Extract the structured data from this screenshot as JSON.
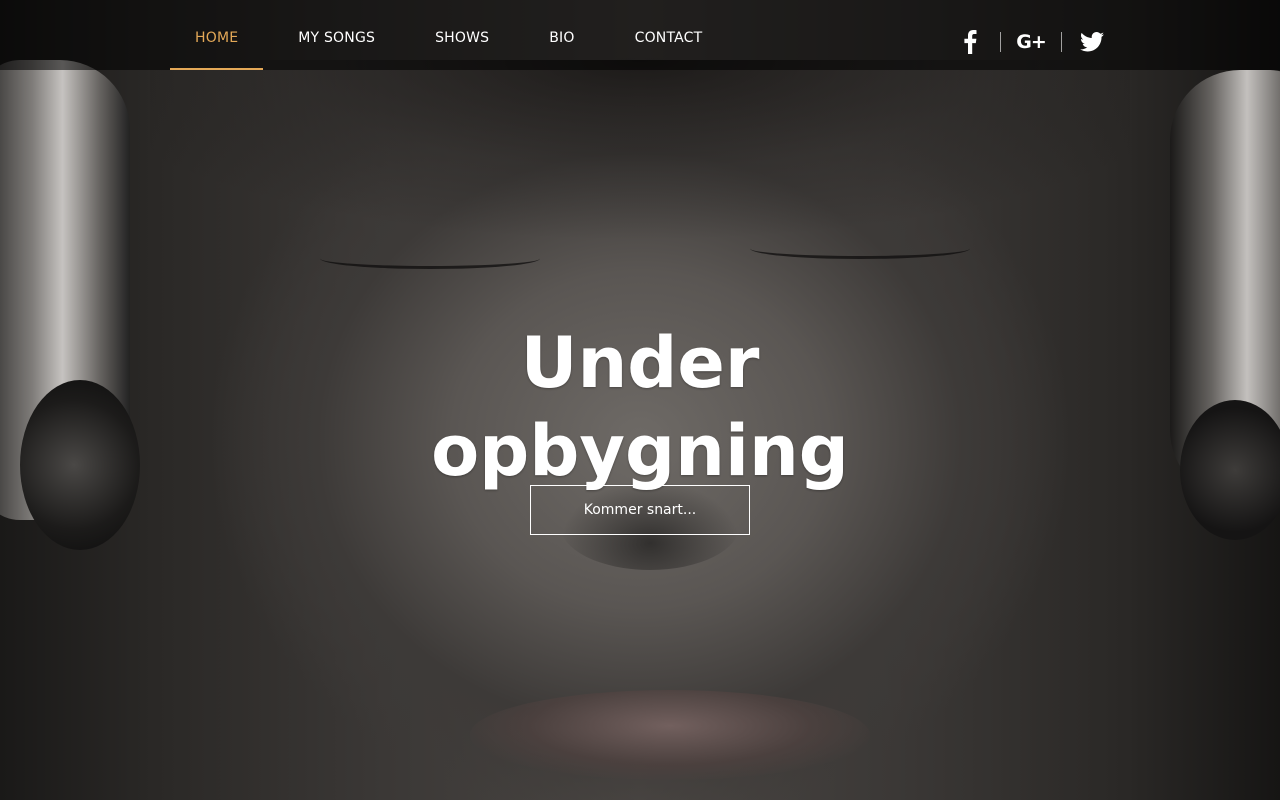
{
  "nav": {
    "items": [
      {
        "label": "HOME",
        "active": true
      },
      {
        "label": "MY SONGS",
        "active": false
      },
      {
        "label": "SHOWS",
        "active": false
      },
      {
        "label": "BIO",
        "active": false
      },
      {
        "label": "CONTACT",
        "active": false
      }
    ],
    "active_color": "#e3a857"
  },
  "social": {
    "icons": [
      "facebook-icon",
      "google-plus-icon",
      "twitter-icon"
    ],
    "google_plus_glyph": "G+"
  },
  "hero": {
    "title_line1": "Under",
    "title_line2": "opbygning",
    "cta_label": "Kommer snart..."
  }
}
